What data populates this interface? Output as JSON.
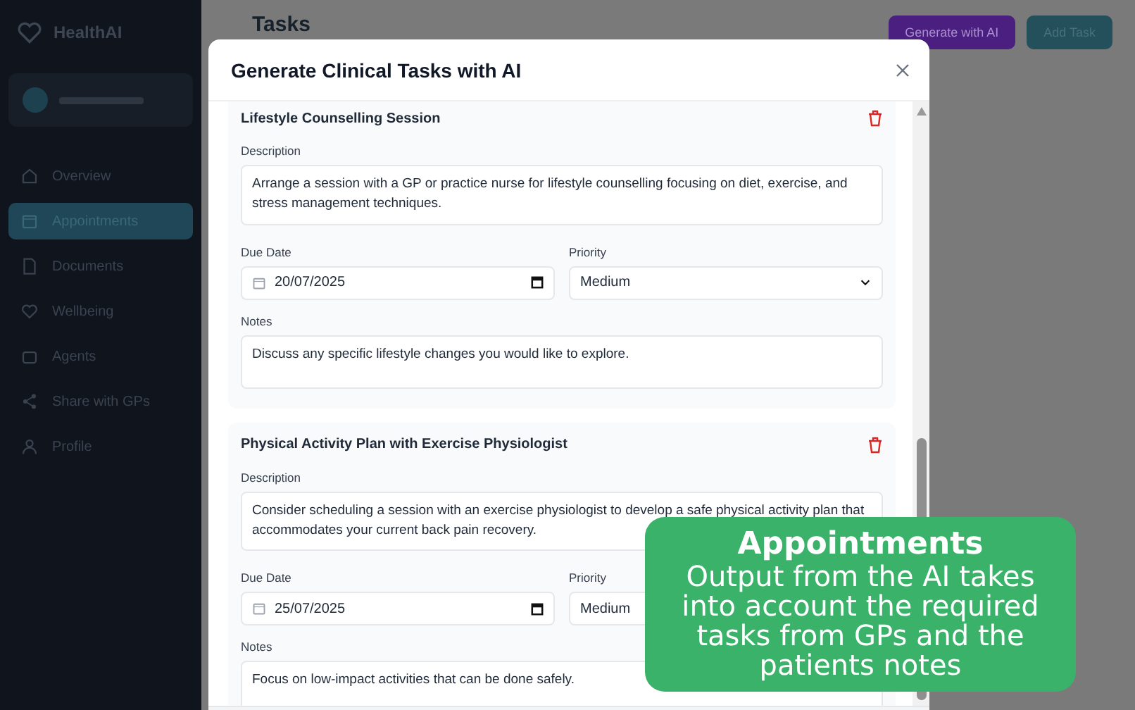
{
  "app": {
    "name": "HealthAI"
  },
  "sidebar": {
    "items": [
      {
        "label": "Overview",
        "selected": false
      },
      {
        "label": "Appointments",
        "selected": true
      },
      {
        "label": "Documents",
        "selected": false
      },
      {
        "label": "Wellbeing",
        "selected": false
      },
      {
        "label": "Agents",
        "selected": false
      },
      {
        "label": "Share with GPs",
        "selected": false
      },
      {
        "label": "Profile",
        "selected": false
      }
    ]
  },
  "page": {
    "title": "Tasks",
    "buttons": [
      {
        "label": "Generate with AI",
        "kind": "ai"
      },
      {
        "label": "Add Task",
        "kind": "add"
      }
    ]
  },
  "modal": {
    "title": "Generate Clinical Tasks with AI",
    "tasks": [
      {
        "title": "Lifestyle Counselling Session",
        "description_label": "Description",
        "description": "Arrange a session with a GP or practice nurse for lifestyle counselling focusing on diet, exercise, and stress management techniques.",
        "due_label": "Due Date",
        "due": "20/07/2025",
        "priority_label": "Priority",
        "priority": "Medium",
        "notes_label": "Notes",
        "notes": "Discuss any specific lifestyle changes you would like to explore."
      },
      {
        "title": "Physical Activity Plan with Exercise Physiologist",
        "description_label": "Description",
        "description": "Consider scheduling a session with an exercise physiologist to develop a safe physical activity plan that accommodates your current back pain recovery.",
        "due_label": "Due Date",
        "due": "25/07/2025",
        "priority_label": "Priority",
        "priority": "Medium",
        "notes_label": "Notes",
        "notes": "Focus on low-impact activities that can be done safely."
      }
    ]
  },
  "callout": {
    "title": "Appointments",
    "text": "Output from the AI takes into account the required tasks from GPs and the patients notes"
  }
}
